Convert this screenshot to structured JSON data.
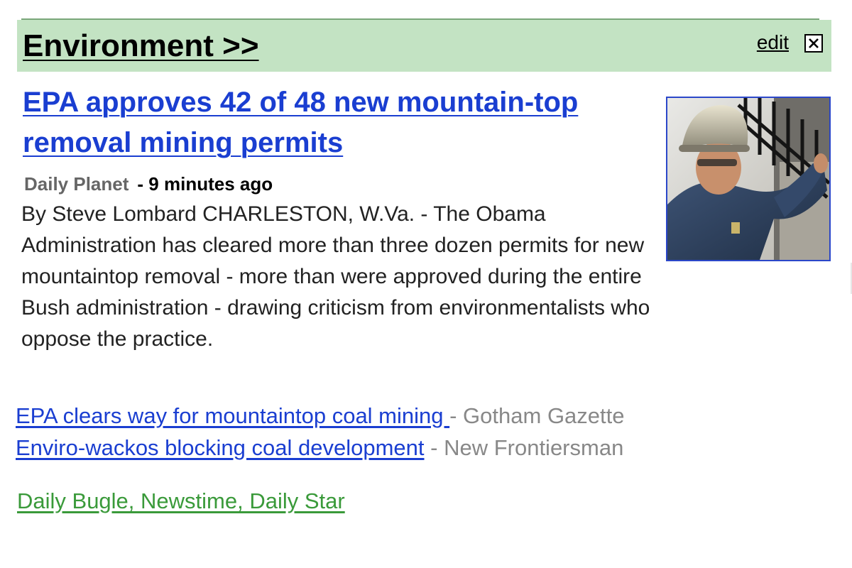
{
  "section": {
    "title": "Environment >>",
    "edit_label": "edit",
    "close_icon": "close-x-icon",
    "colors": {
      "header_bg": "#c3e3c3",
      "header_rule": "#7aa77a"
    }
  },
  "story": {
    "headline": "EPA approves 42 of 48 new mountain-top removal mining permits",
    "source": "Daily Planet",
    "time": "- 9 minutes ago",
    "snippet": "By Steve Lombard CHARLESTON, W.Va. - The Obama Administration has cleared more than three dozen permits for new mountaintop removal - more than were approved during the entire Bush administration - drawing criticism from environmentalists who oppose the practice.",
    "image_icon": "miner-photo",
    "colors": {
      "link": "#1a3ed1",
      "image_border": "#2b47c9"
    }
  },
  "related": [
    {
      "title": "EPA clears way for mountaintop coal mining ",
      "source": "- Gotham Gazette"
    },
    {
      "title": "Enviro-wackos blocking coal development",
      "source": "- New Frontiersman"
    }
  ],
  "more_sources": {
    "label": "Daily Bugle, Newstime, Daily Star",
    "color": "#3a9a3a"
  }
}
